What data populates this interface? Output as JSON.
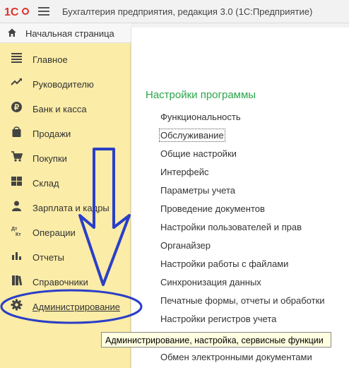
{
  "header": {
    "app_title": "Бухгалтерия предприятия, редакция 3.0  (1С:Предприятие)",
    "logo_text": "1С",
    "menu_icon": "hamburger-menu-icon"
  },
  "homebar": {
    "label": "Начальная страница",
    "icon": "home-icon"
  },
  "sidebar": {
    "items": [
      {
        "label": "Главное",
        "icon": "list-icon"
      },
      {
        "label": "Руководителю",
        "icon": "trend-icon"
      },
      {
        "label": "Банк и касса",
        "icon": "ruble-icon"
      },
      {
        "label": "Продажи",
        "icon": "bag-icon"
      },
      {
        "label": "Покупки",
        "icon": "cart-icon"
      },
      {
        "label": "Склад",
        "icon": "grid-icon"
      },
      {
        "label": "Зарплата и кадры",
        "icon": "person-icon"
      },
      {
        "label": "Операции",
        "icon": "debit-credit-icon"
      },
      {
        "label": "Отчеты",
        "icon": "bar-chart-icon"
      },
      {
        "label": "Справочники",
        "icon": "books-icon"
      },
      {
        "label": "Администрирование",
        "icon": "gear-icon"
      }
    ]
  },
  "main": {
    "section_title": "Настройки программы",
    "links": [
      "Функциональность",
      "Обслуживание",
      "Общие настройки",
      "Интерфейс",
      "Параметры учета",
      "Проведение документов",
      "Настройки пользователей и прав",
      "Органайзер",
      "Настройки работы с файлами",
      "Синхронизация данных",
      "Печатные формы, отчеты и обработки",
      "Настройки регистров учета",
      "Обмен электронными документами"
    ]
  },
  "tooltip": "Администрирование, настройка, сервисные функции",
  "colors": {
    "sidebar_bg": "#fbeca7",
    "accent_green": "#2aa64a",
    "annotation_blue": "#2a3fc7"
  }
}
